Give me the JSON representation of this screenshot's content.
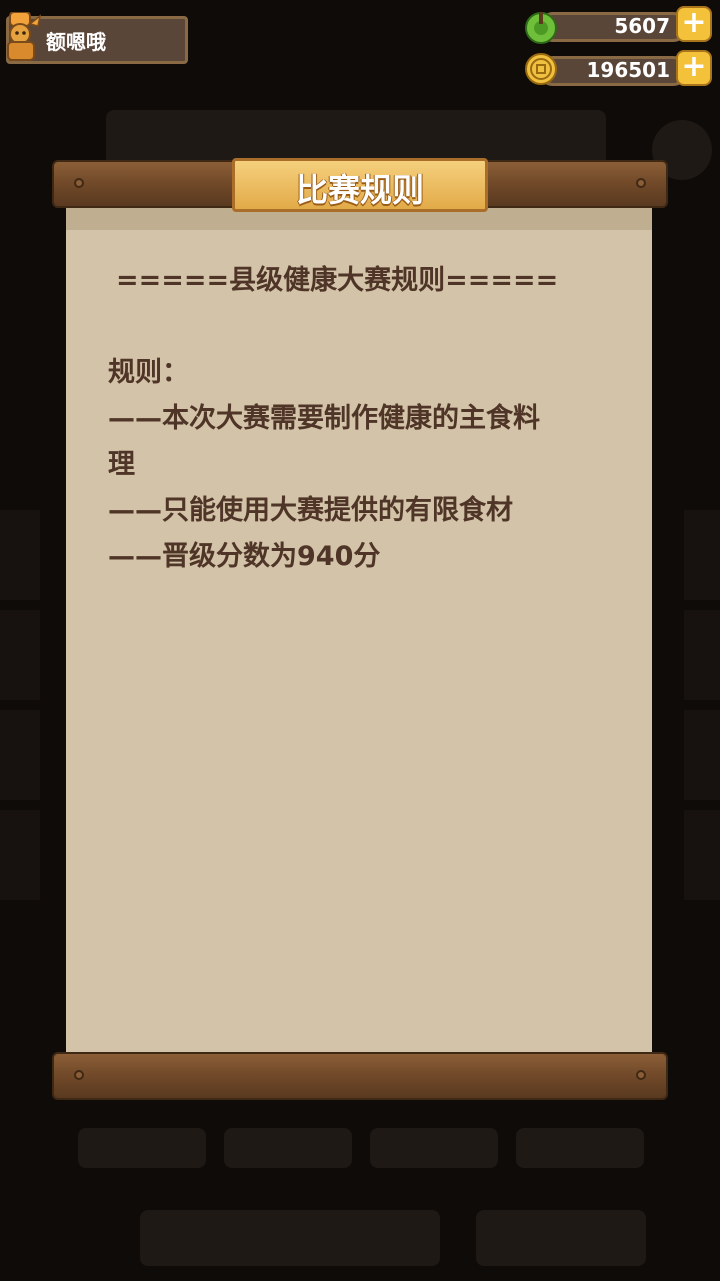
{
  "player": {
    "name": "额嗯哦"
  },
  "currencies": [
    {
      "name": "energy",
      "value": "5607",
      "icon": "green-orb-icon"
    },
    {
      "name": "coins",
      "value": "196501",
      "icon": "coin-icon"
    }
  ],
  "dialog": {
    "title": "比赛规则",
    "heading": "=====县级健康大赛规则=====",
    "rules_label": "规则：",
    "rules": [
      "——本次大赛需要制作健康的主食料",
      "理",
      "——只能使用大赛提供的有限食材",
      "——晋级分数为940分"
    ]
  },
  "colors": {
    "paper": "#d3c3a8",
    "rule_text": "#4f3527",
    "title_plate": "#f0c060",
    "wood": "#6b4526",
    "plus_button": "#f3c23a"
  }
}
